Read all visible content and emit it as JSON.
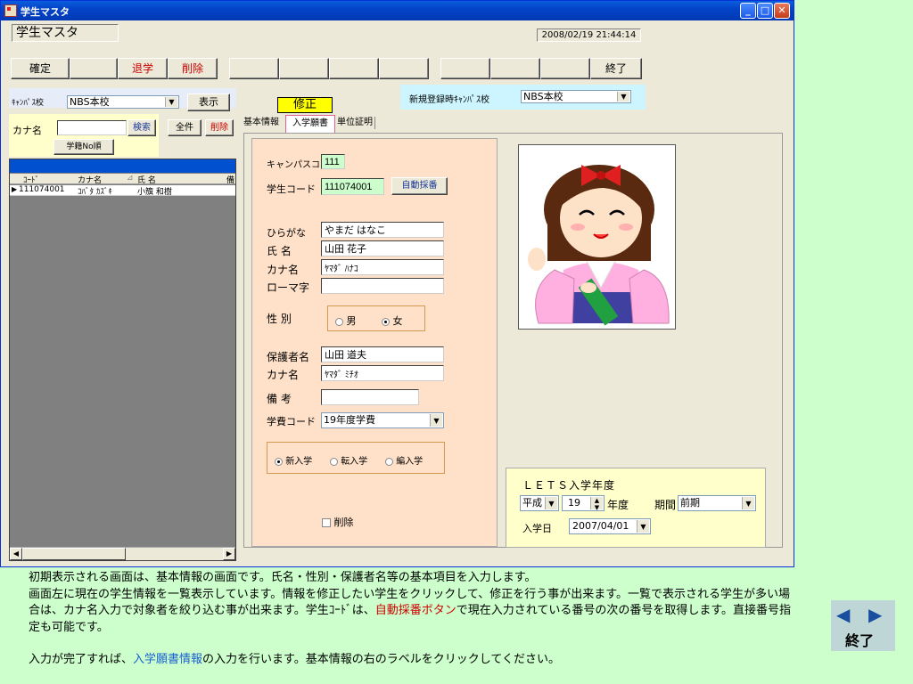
{
  "window": {
    "title": "学生マスタ"
  },
  "header": {
    "form_label": "学生マスタ",
    "datetime": "2008/02/19 21:44:14"
  },
  "toolbar": {
    "confirm": "確定",
    "withdraw": "退学",
    "delete": "削除",
    "end": "終了"
  },
  "campus": {
    "label": "ｷｬﾝﾊﾟｽ校",
    "value": "NBS本校",
    "show_button": "表示"
  },
  "kana_search": {
    "label": "カナ名",
    "value": "",
    "search_button": "検索",
    "all_button": "全件",
    "delete_button": "削除",
    "reg_order_button": "学籍No順"
  },
  "mode_badge": "修正",
  "new_campus": {
    "label": "新規登録時ｷｬﾝﾊﾟｽ校",
    "value": "NBS本校"
  },
  "student_list": {
    "columns": [
      "ｺｰﾄﾞ",
      "カナ名",
      "氏 名",
      "備"
    ],
    "rows": [
      {
        "code": "111074001",
        "kana": "ｺﾊﾞﾀ ｶｽﾞｷ",
        "name": "小籏 和樹"
      }
    ]
  },
  "tabs": [
    "基本情報",
    "入学願書",
    "単位証明"
  ],
  "form": {
    "campus_code_label": "キャンパスコード",
    "campus_code": "111",
    "student_code_label": "学生コード",
    "student_code": "111074001",
    "auto_number_button": "自動採番",
    "hiragana_label": "ひらがな",
    "hiragana": "やまだ はなこ",
    "name_label": "氏 名",
    "name": "山田 花子",
    "kana_label": "カナ名",
    "kana": "ﾔﾏﾀﾞ ﾊﾅｺ",
    "romaji_label": "ローマ字",
    "romaji": "",
    "gender_label": "性 別",
    "male": "男",
    "female": "女",
    "guardian_label": "保護者名",
    "guardian": "山田 道夫",
    "guardian_kana_label": "カナ名",
    "guardian_kana": "ﾔﾏﾀﾞ ﾐﾁｵ",
    "remarks_label": "備 考",
    "remarks": "",
    "fee_code_label": "学費コード",
    "fee_code": "19年度学費",
    "admission_types": [
      "新入学",
      "転入学",
      "編入学"
    ],
    "delete_check": "削除"
  },
  "lets": {
    "title": "ＬＥＴＳ入学年度",
    "era": "平成",
    "year": "19",
    "year_unit": "年度",
    "period_label": "期間",
    "period": "前期",
    "entry_date_label": "入学日",
    "entry_date": "2007/04/01"
  },
  "description": {
    "p1": "初期表示される画面は、基本情報の画面です。氏名・性別・保護者名等の基本項目を入力します。",
    "p2a": "画面左に現在の学生情報を一覧表示しています。情報を修正したい学生をクリックして、修正を行う事が出来ます。一覧で表示される学生が多い場合は、カナ名入力で対象者を絞り込む事が出来ます。学生ｺｰﾄﾞは、",
    "p2link": "自動採番ボタン",
    "p2b": "で現在入力されている番号の次の番号を取得します。直接番号指定も可能です。",
    "p3a": "入力が完了すれば、",
    "p3link": "入学願書情報",
    "p3b": "の入力を行います。基本情報の右のラベルをクリックしてください。"
  },
  "nav": {
    "end_label": "終了"
  }
}
